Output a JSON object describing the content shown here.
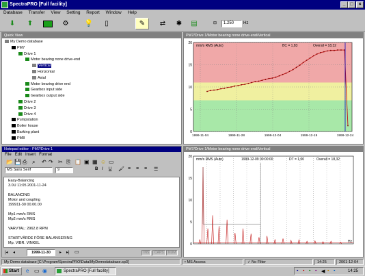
{
  "app": {
    "title": "SpectraPRO [Full facility]"
  },
  "menu": [
    "Database",
    "Transfer",
    "View",
    "Setting",
    "Report",
    "Window",
    "Help"
  ],
  "toolbar": {
    "speed_value": "1.250",
    "speed_unit": "Hz"
  },
  "quickview": {
    "title": "Quick View",
    "items": [
      {
        "label": "My Demo database",
        "indent": 0,
        "icon": "db-icon"
      },
      {
        "label": "PM7",
        "indent": 1,
        "icon": "machine-icon"
      },
      {
        "label": "Drive 1",
        "indent": 2,
        "icon": "drive-icon"
      },
      {
        "label": "Motor bearing none drive-end",
        "indent": 3,
        "icon": "bearing-icon"
      },
      {
        "label": "Vertical",
        "indent": 4,
        "icon": "sensor-icon",
        "selected": true
      },
      {
        "label": "Horizontal",
        "indent": 4,
        "icon": "sensor-icon"
      },
      {
        "label": "Axial",
        "indent": 4,
        "icon": "sensor-icon"
      },
      {
        "label": "Motor bearing drive end",
        "indent": 3,
        "icon": "bearing-icon"
      },
      {
        "label": "Gearbox input side",
        "indent": 3,
        "icon": "bearing-icon"
      },
      {
        "label": "Gearbox output side",
        "indent": 3,
        "icon": "bearing-icon"
      },
      {
        "label": "Drive 2",
        "indent": 2,
        "icon": "drive-icon"
      },
      {
        "label": "Drive 3",
        "indent": 2,
        "icon": "drive-icon"
      },
      {
        "label": "Drive 4",
        "indent": 2,
        "icon": "drive-icon"
      },
      {
        "label": "Pumpstation",
        "indent": 1,
        "icon": "machine-icon"
      },
      {
        "label": "Boiler house",
        "indent": 1,
        "icon": "machine-icon"
      },
      {
        "label": "Barking plant",
        "indent": 1,
        "icon": "machine-icon"
      },
      {
        "label": "PM8",
        "indent": 1,
        "icon": "machine-icon"
      }
    ]
  },
  "trend": {
    "title": "PM7/Drive 1/Motor bearing none drive-end/Vertical",
    "unit": "mm/s RMS (Auto)",
    "bc": "BC = 1,83",
    "overall": "Overall = 18,32"
  },
  "spectrum": {
    "title": "PM7/Drive 1/Motor bearing none drive-end/Vertical",
    "unit": "mm/s RMS (Auto)",
    "date": "1999-12-09 00:00:00",
    "dt": "DT = 1,00",
    "overall": "Overall = 18,32",
    "xunit": "Hz"
  },
  "notepad": {
    "title": "Notepad editor - PM7/Drive 1",
    "menu": [
      "File",
      "Edit",
      "Insert",
      "Format"
    ],
    "font": "MS Sans Serif",
    "size": "9",
    "lines": [
      "Easy-Balancing",
      "3.0U 11:05 2001-11-24",
      "",
      "BALANCING",
      "Motor and coupling",
      "199911-30 00.00.00",
      "",
      "Mp1 mm/s RMS",
      "Mp2 mm/s RMS",
      "",
      "VARVTAL: 2962.8 RPM",
      "",
      "STARTVÄRDE FÖRE BALANSERING",
      "Mp. VIBR.        VINKEL"
    ],
    "date_nav": "1999-11-30",
    "status_flags": [
      "INS",
      "CAPS",
      "NUM"
    ]
  },
  "status": {
    "db": "My Demo database",
    "path": "[C:\\Program\\SpectraPRO\\Data\\MyDemodatabase.sp3]",
    "access": "MS Access",
    "filter": "No Filter",
    "time": "14:25",
    "date": "2001-12-04"
  },
  "taskbar": {
    "start": "Start",
    "task": "SpectraPRO [Full facility]",
    "clock": "14:25"
  },
  "chart_data": [
    {
      "type": "line",
      "title": "",
      "ylabel": "mm/s RMS (Auto)",
      "ylim": [
        0,
        20
      ],
      "yticks": [
        0,
        5,
        10,
        15,
        20
      ],
      "xticks": [
        "1999-11-04",
        "1999-11-28",
        "1999-12-04",
        "1999-12-19",
        "1999-12-24"
      ],
      "bands": [
        {
          "from": 0,
          "to": 7,
          "color": "#a8e8a8"
        },
        {
          "from": 7,
          "to": 11,
          "color": "#f0f0a0"
        },
        {
          "from": 11,
          "to": 20,
          "color": "#f0a8a8"
        }
      ],
      "series": [
        {
          "values": [
            9.0,
            9.2,
            9.3,
            9.4,
            9.6,
            9.7,
            9.9,
            10.0,
            10.2,
            10.3,
            10.5,
            10.6,
            10.8,
            11.0,
            11.2,
            11.3,
            11.5,
            11.7,
            11.9,
            12.0,
            12.2,
            12.5,
            12.8,
            13.1,
            13.5,
            13.9,
            14.4,
            14.9,
            15.5,
            16.0,
            16.5,
            17.0,
            17.4,
            17.7,
            17.9,
            18.1,
            18.2,
            18.2,
            18.3,
            18.3,
            18.3,
            1.3
          ]
        }
      ]
    },
    {
      "type": "bar",
      "title": "",
      "ylabel": "mm/s RMS (Auto)",
      "ylim": [
        0,
        20
      ],
      "yticks": [
        0,
        5,
        10,
        15,
        20
      ],
      "peaks": [
        {
          "x": 0.04,
          "y": 1.0
        },
        {
          "x": 0.06,
          "y": 17.5
        },
        {
          "x": 0.09,
          "y": 3.5
        },
        {
          "x": 0.12,
          "y": 6.5
        },
        {
          "x": 0.16,
          "y": 4.0
        },
        {
          "x": 0.21,
          "y": 5.5
        },
        {
          "x": 0.26,
          "y": 2.5
        },
        {
          "x": 0.31,
          "y": 3.5
        },
        {
          "x": 0.36,
          "y": 2.3
        },
        {
          "x": 0.41,
          "y": 1.5
        },
        {
          "x": 0.46,
          "y": 1.8
        },
        {
          "x": 0.51,
          "y": 1.0
        },
        {
          "x": 0.56,
          "y": 1.2
        },
        {
          "x": 0.61,
          "y": 0.8
        },
        {
          "x": 0.66,
          "y": 0.9
        },
        {
          "x": 0.71,
          "y": 0.6
        },
        {
          "x": 0.76,
          "y": 0.7
        },
        {
          "x": 0.81,
          "y": 0.5
        },
        {
          "x": 0.86,
          "y": 0.6
        },
        {
          "x": 0.92,
          "y": 0.4
        }
      ]
    }
  ]
}
